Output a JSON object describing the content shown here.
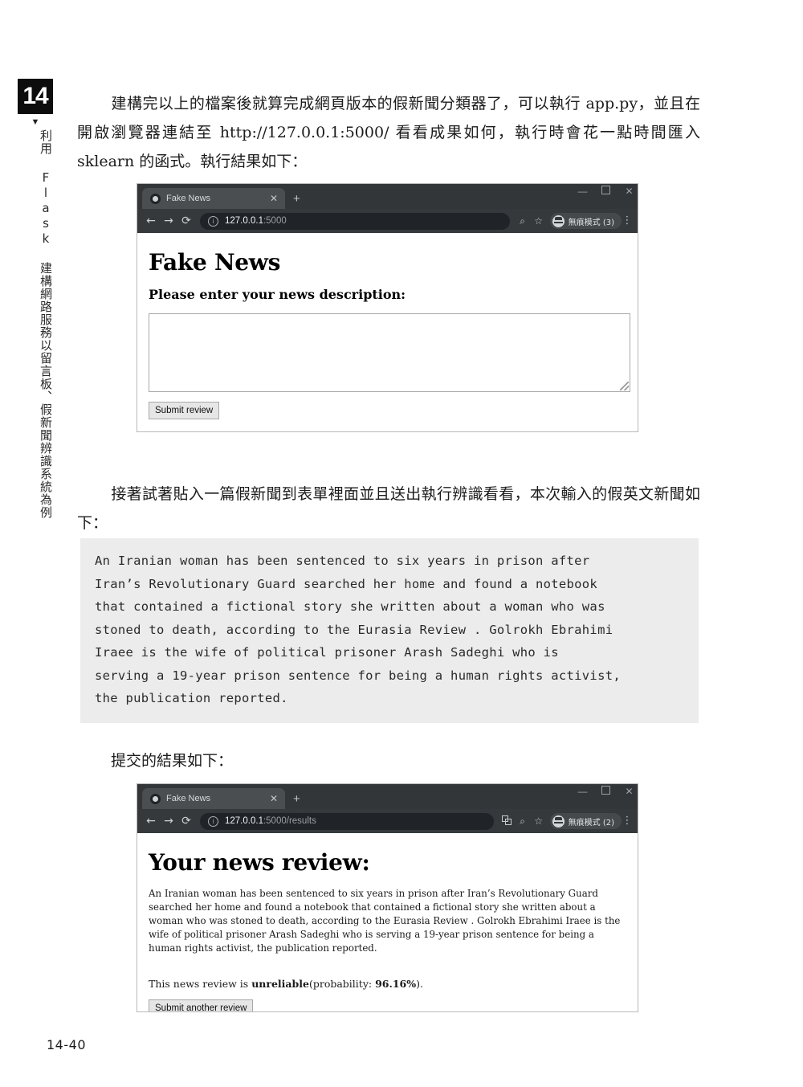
{
  "chapter_tab": {
    "number": "14",
    "caret": "▼",
    "vertical_title": "利用 Flask 建構網路服務以留言板、假新聞辨識系統為例"
  },
  "paragraphs": {
    "intro": "建構完以上的檔案後就算完成網頁版本的假新聞分類器了，可以執行 app.py，並且在開啟瀏覽器連結至 http://127.0.0.1:5000/ 看看成果如何，執行時會花一點時間匯入 sklearn 的函式。執行結果如下：",
    "paste": "接著試著貼入一篇假新聞到表單裡面並且送出執行辨識看看，本次輸入的假英文新聞如下：",
    "result": "提交的結果如下："
  },
  "code_block": {
    "text": "An Iranian woman has been sentenced to six years in prison after\nIran’s Revolutionary Guard searched her home and found a notebook\nthat contained a fictional story she written about a woman who was\nstoned to death, according to the Eurasia Review . Golrokh Ebrahimi\nIraee is the wife of political prisoner Arash Sadeghi who is\nserving a 19-year prison sentence for being a human rights activist,\nthe publication reported.",
    "background": "#ececec"
  },
  "browser_form": {
    "tab": {
      "title": "Fake News",
      "close_label": "✕",
      "new_tab_label": "+"
    },
    "window_controls": {
      "minimize": "—",
      "maximize": "",
      "close": "✕"
    },
    "toolbar": {
      "back": "←",
      "forward": "→",
      "reload": "⟳",
      "info": "ⓘ",
      "url_host": "127.0.0.1",
      "url_rest": ":5000",
      "zoom_icon": "⌕",
      "star_icon": "☆",
      "incognito_label": "無痕模式 (3)",
      "menu": "⋮"
    },
    "page": {
      "title": "Fake News",
      "prompt": "Please enter your news description:",
      "textarea_value": "",
      "textarea_placeholder": "",
      "submit_label": "Submit review"
    }
  },
  "browser_result": {
    "tab": {
      "title": "Fake News",
      "close_label": "✕",
      "new_tab_label": "+"
    },
    "window_controls": {
      "minimize": "—",
      "maximize": "",
      "close": "✕"
    },
    "toolbar": {
      "back": "←",
      "forward": "→",
      "reload": "⟳",
      "info": "ⓘ",
      "url_host": "127.0.0.1",
      "url_rest": ":5000/results",
      "translate_icon": "🗗",
      "zoom_icon": "⌕",
      "star_icon": "☆",
      "incognito_label": "無痕模式 (2)",
      "menu": "⋮"
    },
    "page": {
      "title": "Your news review:",
      "review_text": "An Iranian woman has been sentenced to six years in prison after Iran’s Revolutionary Guard searched her home and found a notebook that contained a fictional story she written about a woman who was stoned to death, according to the Eurasia Review . Golrokh Ebrahimi Iraee is the wife of political prisoner Arash Sadeghi who is serving a 19-year prison sentence for being a human rights activist, the publication reported.",
      "verdict_prefix": "This news review is ",
      "verdict_label": "unreliable",
      "verdict_middle": "(probability: ",
      "verdict_probability": "96.16%",
      "verdict_suffix": ").",
      "submit_label": "Submit another review"
    }
  },
  "folio": "14-40"
}
